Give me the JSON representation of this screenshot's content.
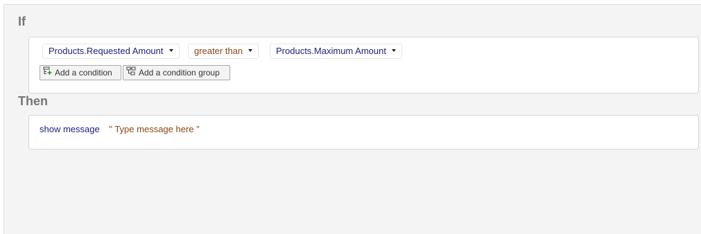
{
  "if_section": {
    "label": "If",
    "condition": {
      "left_field": "Products.Requested Amount",
      "operator": "greater than",
      "right_field": "Products.Maximum Amount"
    },
    "buttons": {
      "add_condition": "Add a condition",
      "add_condition_group": "Add a condition group"
    }
  },
  "then_section": {
    "label": "Then",
    "action": {
      "name": "show message",
      "message": "\" Type message here \""
    }
  },
  "colors": {
    "field_text": "#1a237e",
    "operator_text": "#8b4513",
    "section_label": "#777777",
    "panel_bg": "#f4f4f4"
  },
  "icons": [
    "add-condition-icon",
    "add-condition-group-icon",
    "caret-down-icon"
  ]
}
